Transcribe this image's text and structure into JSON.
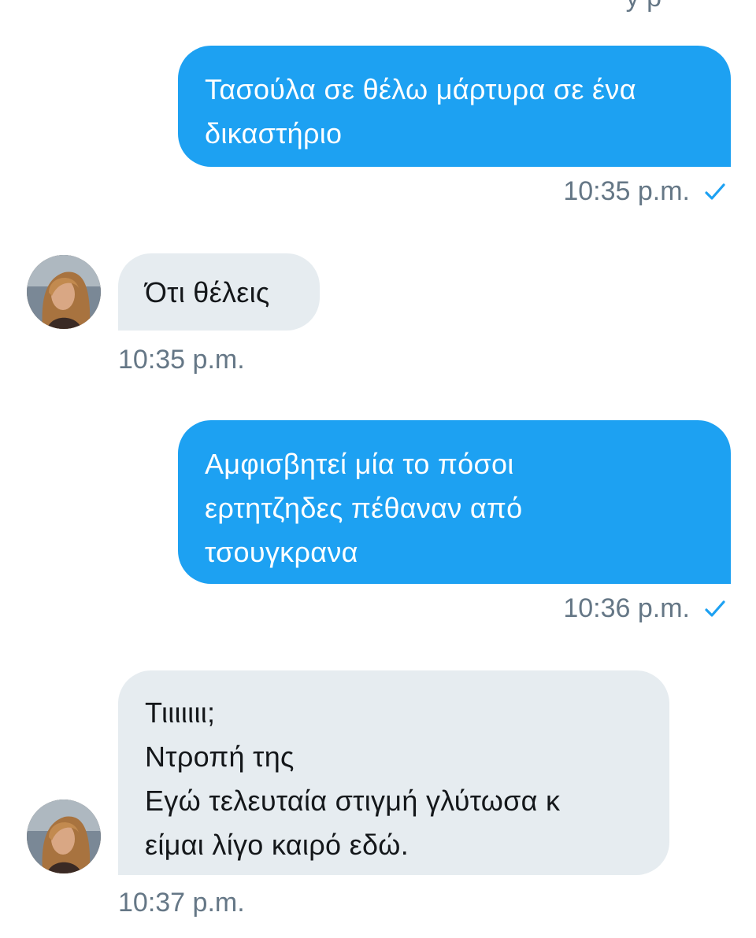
{
  "messages": [
    {
      "direction": "sent",
      "lines": [
        "Τασούλα σε θέλω μάρτυρα σε ένα",
        "δικαστήριο"
      ],
      "time": "10:35 p.m.",
      "status_icon": "check-icon"
    },
    {
      "direction": "received",
      "lines": [
        "Ότι θέλεις"
      ],
      "time": "10:35 p.m.",
      "avatar": "avatar"
    },
    {
      "direction": "sent",
      "lines": [
        "Αμφισβητεί μία το πόσοι",
        "ερτητζηδες πέθαναν από",
        "τσουγκρανα"
      ],
      "time": "10:36 p.m.",
      "status_icon": "check-icon"
    },
    {
      "direction": "received",
      "lines": [
        "Τιιιιιιι;",
        "Ντροπή της",
        "Εγώ τελευταία στιγμή γλύτωσα κ",
        "είμαι λίγο καιρό εδώ."
      ],
      "time": "10:37 p.m.",
      "avatar": "avatar"
    }
  ],
  "colors": {
    "sent_bubble": "#1da1f2",
    "received_bubble": "#e6ecf0",
    "meta_text": "#657786",
    "check": "#1da1f2"
  }
}
